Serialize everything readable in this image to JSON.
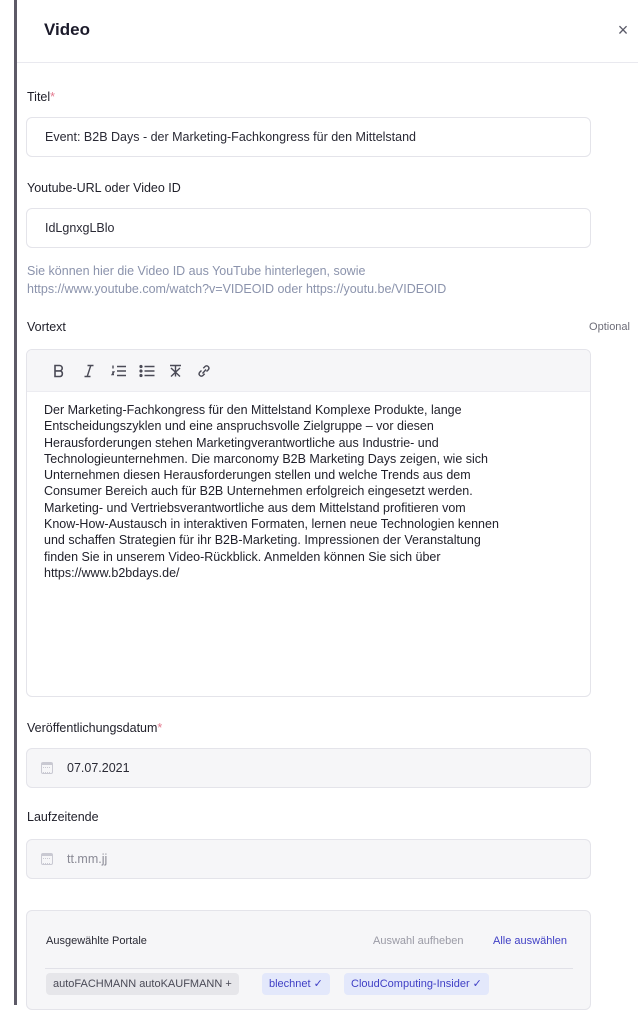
{
  "panel": {
    "title": "Video",
    "close_symbol": "×"
  },
  "fields": {
    "title": {
      "label": "Titel",
      "required_mark": "*",
      "value": "Event: B2B Days - der Marketing-Fachkongress für den Mittelstand"
    },
    "youtube": {
      "label": "Youtube-URL oder Video ID",
      "value": "IdLgnxgLBlo",
      "hint_line1": "Sie können hier die Video ID aus YouTube hinterlegen, sowie",
      "hint_line2": "https://www.youtube.com/watch?v=VIDEOID oder https://youtu.be/VIDEOID"
    },
    "pretext": {
      "label": "Vortext",
      "optional_label": "Optional",
      "toolbar": [
        "bold-icon",
        "italic-icon",
        "ordered-list-icon",
        "bullet-list-icon",
        "clear-format-icon",
        "link-icon"
      ],
      "lines": [
        "Der Marketing-Fachkongress für den Mittelstand Komplexe Produkte, lange",
        "Entscheidungszyklen und eine anspruchsvolle Zielgruppe – vor diesen",
        "Herausforderungen stehen Marketingverantwortliche aus Industrie- und",
        "Technologieunternehmen. Die marconomy B2B Marketing Days zeigen, wie sich",
        "Unternehmen diesen Herausforderungen stellen und welche Trends aus dem",
        "Consumer Bereich auch für B2B Unternehmen erfolgreich eingesetzt werden.",
        "Marketing- und Vertriebsverantwortliche aus dem Mittelstand profitieren vom",
        "Know-How-Austausch in interaktiven Formaten, lernen neue Technologien kennen",
        "und schaffen Strategien für ihr B2B-Marketing. Impressionen der Veranstaltung",
        "finden Sie in unserem Video-Rückblick. Anmelden können Sie sich über",
        "https://www.b2bdays.de/"
      ]
    },
    "publish_date": {
      "label": "Veröffentlichungsdatum",
      "required_mark": "*",
      "value": "07.07.2021"
    },
    "end_date": {
      "label": "Laufzeitende",
      "placeholder": "tt.mm.jj"
    }
  },
  "portals": {
    "title": "Ausgewählte Portale",
    "clear_label": "Auswahl aufheben",
    "select_all_label": "Alle auswählen",
    "chips": [
      {
        "label": "autoFACHMANN autoKAUFMANN +",
        "selected": false
      },
      {
        "label": "blechnet ✓",
        "selected": true
      },
      {
        "label": "CloudComputing-Insider ✓",
        "selected": true
      }
    ]
  },
  "colors": {
    "accent": "#3f3fc5",
    "required": "#e37a8f",
    "hint": "#8b93ac"
  }
}
